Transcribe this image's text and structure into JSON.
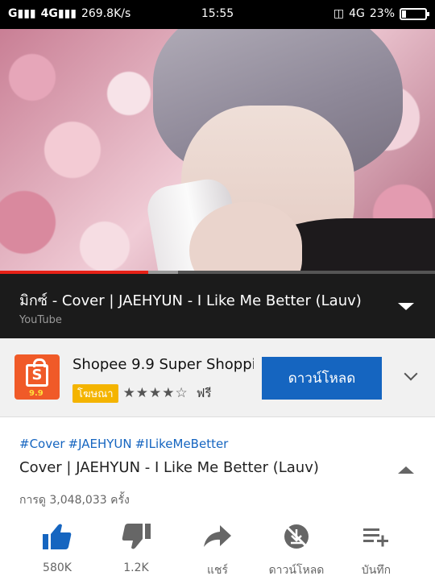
{
  "status_bar": {
    "signal_1": "G",
    "network_2": "4G",
    "speed": "269.8K/s",
    "time": "15:55",
    "right_network": "4G",
    "battery_percent": "23%",
    "battery_level": 0.23
  },
  "video": {
    "progress_fraction": 0.34,
    "buffered_fraction": 0.41
  },
  "now_playing": {
    "title": "มิกซ์ - Cover | JAEHYUN - I Like Me Better (Lauv)",
    "channel": "YouTube"
  },
  "ad": {
    "title": "Shopee 9.9 Super Shoppi...",
    "badge": "โฆษณา",
    "stars": "★★★★☆",
    "rating": 4,
    "price": "ฟรี",
    "cta": "ดาวน์โหลด",
    "logo_text": "S",
    "logo_promo": "9.9",
    "logo_color": "#f05a28"
  },
  "details": {
    "hashtags": [
      "#Cover",
      "#JAEHYUN",
      "#ILikeMeBetter"
    ],
    "title": "Cover | JAEHYUN - I Like Me Better (Lauv)",
    "views": "การดู 3,048,033 ครั้ง"
  },
  "actions": [
    {
      "icon": "thumbs-up-icon",
      "label": "580K"
    },
    {
      "icon": "thumbs-down-icon",
      "label": "1.2K"
    },
    {
      "icon": "share-icon",
      "label": "แชร์"
    },
    {
      "icon": "download-icon",
      "label": "ดาวน์โหลด"
    },
    {
      "icon": "save-playlist-icon",
      "label": "บันทึก"
    }
  ],
  "colors": {
    "accent": "#1565c0",
    "progress": "#e62117",
    "like_active": "#1565c0",
    "icon_gray": "#666666"
  }
}
